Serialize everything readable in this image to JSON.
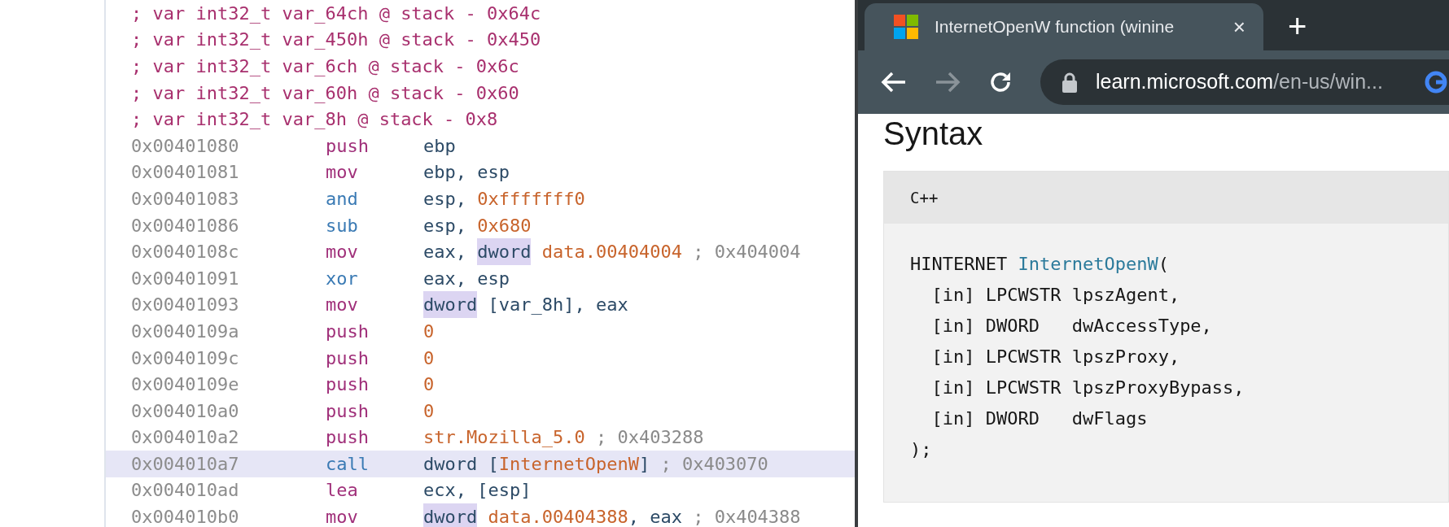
{
  "disassembly": {
    "lines": [
      {
        "kind": "comment",
        "text": "; var int32_t var_64ch @ stack - 0x64c",
        "selected": false
      },
      {
        "kind": "comment",
        "text": "; var int32_t var_450h @ stack - 0x450",
        "selected": false
      },
      {
        "kind": "comment",
        "text": "; var int32_t var_6ch @ stack - 0x6c",
        "selected": false
      },
      {
        "kind": "comment",
        "text": "; var int32_t var_60h @ stack - 0x60",
        "selected": false
      },
      {
        "kind": "comment",
        "text": "; var int32_t var_8h @ stack - 0x8",
        "selected": false
      },
      {
        "kind": "instruction",
        "address": "0x00401080",
        "mnemonic": "push",
        "color": "#a0307a",
        "selected": false,
        "operands": [
          {
            "text": "ebp",
            "kind": "reg",
            "highlighted": false
          }
        ]
      },
      {
        "kind": "instruction",
        "address": "0x00401081",
        "mnemonic": "mov",
        "color": "#a0307a",
        "selected": false,
        "operands": [
          {
            "text": "ebp, esp",
            "kind": "reg",
            "highlighted": false
          }
        ]
      },
      {
        "kind": "instruction",
        "address": "0x00401083",
        "mnemonic": "and",
        "color": "#3a7ab4",
        "selected": false,
        "operands": [
          {
            "text": "esp, ",
            "kind": "reg",
            "highlighted": false
          },
          {
            "text": "0xfffffff0",
            "kind": "num",
            "highlighted": false
          }
        ]
      },
      {
        "kind": "instruction",
        "address": "0x00401086",
        "mnemonic": "sub",
        "color": "#3a7ab4",
        "selected": false,
        "operands": [
          {
            "text": "esp, ",
            "kind": "reg",
            "highlighted": false
          },
          {
            "text": "0x680",
            "kind": "num",
            "highlighted": false
          }
        ]
      },
      {
        "kind": "instruction",
        "address": "0x0040108c",
        "mnemonic": "mov",
        "color": "#a0307a",
        "selected": false,
        "operands": [
          {
            "text": "eax, ",
            "kind": "reg",
            "highlighted": false
          },
          {
            "text": "dword",
            "kind": "reg",
            "highlighted": true
          },
          {
            "text": " data.00404004",
            "kind": "num",
            "highlighted": false
          },
          {
            "text": " ; 0x404004",
            "kind": "comment",
            "highlighted": false
          }
        ]
      },
      {
        "kind": "instruction",
        "address": "0x00401091",
        "mnemonic": "xor",
        "color": "#3a7ab4",
        "selected": false,
        "operands": [
          {
            "text": "eax, esp",
            "kind": "reg",
            "highlighted": false
          }
        ]
      },
      {
        "kind": "instruction",
        "address": "0x00401093",
        "mnemonic": "mov",
        "color": "#a0307a",
        "selected": false,
        "operands": [
          {
            "text": "dword",
            "kind": "reg",
            "highlighted": true
          },
          {
            "text": " [var_8h], eax",
            "kind": "reg",
            "highlighted": false
          }
        ]
      },
      {
        "kind": "instruction",
        "address": "0x0040109a",
        "mnemonic": "push",
        "color": "#a0307a",
        "selected": false,
        "operands": [
          {
            "text": "0",
            "kind": "num",
            "highlighted": false
          }
        ]
      },
      {
        "kind": "instruction",
        "address": "0x0040109c",
        "mnemonic": "push",
        "color": "#a0307a",
        "selected": false,
        "operands": [
          {
            "text": "0",
            "kind": "num",
            "highlighted": false
          }
        ]
      },
      {
        "kind": "instruction",
        "address": "0x0040109e",
        "mnemonic": "push",
        "color": "#a0307a",
        "selected": false,
        "operands": [
          {
            "text": "0",
            "kind": "num",
            "highlighted": false
          }
        ]
      },
      {
        "kind": "instruction",
        "address": "0x004010a0",
        "mnemonic": "push",
        "color": "#a0307a",
        "selected": false,
        "operands": [
          {
            "text": "0",
            "kind": "num",
            "highlighted": false
          }
        ]
      },
      {
        "kind": "instruction",
        "address": "0x004010a2",
        "mnemonic": "push",
        "color": "#a0307a",
        "selected": false,
        "operands": [
          {
            "text": "str.Mozilla_5.0",
            "kind": "num",
            "highlighted": false
          },
          {
            "text": " ; 0x403288",
            "kind": "comment",
            "highlighted": false
          }
        ]
      },
      {
        "kind": "instruction",
        "address": "0x004010a7",
        "mnemonic": "call",
        "color": "#3a7ab4",
        "selected": true,
        "operands": [
          {
            "text": "dword [",
            "kind": "reg",
            "highlighted": false
          },
          {
            "text": "InternetOpenW",
            "kind": "num",
            "highlighted": false
          },
          {
            "text": "]",
            "kind": "reg",
            "highlighted": false
          },
          {
            "text": " ; 0x403070",
            "kind": "comment",
            "highlighted": false
          }
        ]
      },
      {
        "kind": "instruction",
        "address": "0x004010ad",
        "mnemonic": "lea",
        "color": "#a0307a",
        "selected": false,
        "operands": [
          {
            "text": "ecx, [esp]",
            "kind": "reg",
            "highlighted": false
          }
        ]
      },
      {
        "kind": "instruction",
        "address": "0x004010b0",
        "mnemonic": "mov",
        "color": "#a0307a",
        "selected": false,
        "operands": [
          {
            "text": "dword",
            "kind": "reg",
            "highlighted": true
          },
          {
            "text": " data.00404388",
            "kind": "num",
            "highlighted": false
          },
          {
            "text": ", eax",
            "kind": "reg",
            "highlighted": false
          },
          {
            "text": " ; 0x404388",
            "kind": "comment",
            "highlighted": false
          }
        ]
      }
    ]
  },
  "browser": {
    "tab": {
      "title": "InternetOpenW function (winine",
      "close": "×"
    },
    "new_tab": "+",
    "address_bar": {
      "domain": "learn.microsoft.com",
      "path": "/en-us/win..."
    },
    "page": {
      "heading": "Syntax",
      "code_block": {
        "language": "C++",
        "lines": [
          [
            {
              "text": "HINTERNET ",
              "kind": "plain"
            },
            {
              "text": "InternetOpenW",
              "kind": "func"
            },
            {
              "text": "(",
              "kind": "plain"
            }
          ],
          [
            {
              "text": "  [in] LPCWSTR lpszAgent,",
              "kind": "plain"
            }
          ],
          [
            {
              "text": "  [in] DWORD   dwAccessType,",
              "kind": "plain"
            }
          ],
          [
            {
              "text": "  [in] LPCWSTR lpszProxy,",
              "kind": "plain"
            }
          ],
          [
            {
              "text": "  [in] LPCWSTR lpszProxyBypass,",
              "kind": "plain"
            }
          ],
          [
            {
              "text": "  [in] DWORD   dwFlags",
              "kind": "plain"
            }
          ],
          [
            {
              "text": ");",
              "kind": "plain"
            }
          ]
        ]
      }
    }
  }
}
